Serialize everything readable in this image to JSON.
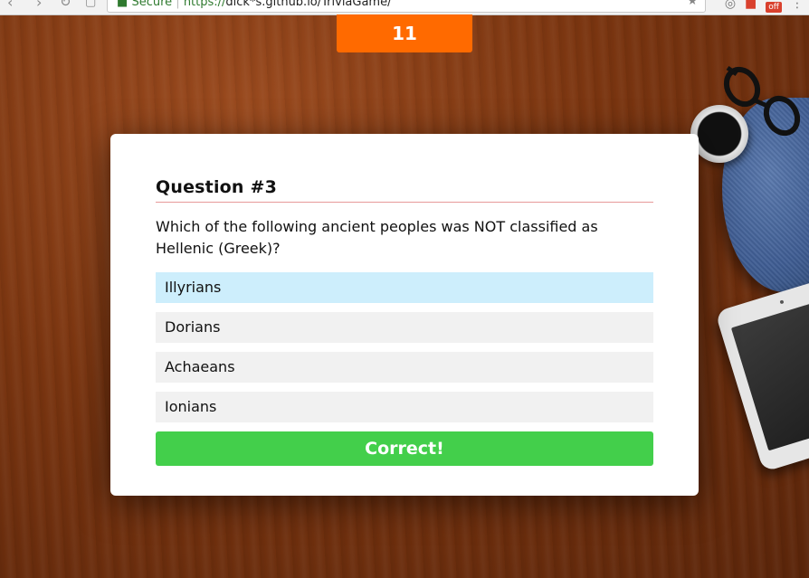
{
  "browser": {
    "secure_label": "Secure",
    "url_prefix": "https://",
    "url_rest": "dick*s.github.io/TriviaGame/",
    "off_badge": "off"
  },
  "timer": {
    "value": "11"
  },
  "quiz": {
    "title": "Question #3",
    "question": "Which of the following ancient peoples was NOT classified as Hellenic (Greek)?",
    "answers": [
      {
        "label": "Illyrians",
        "selected": true
      },
      {
        "label": "Dorians",
        "selected": false
      },
      {
        "label": "Achaeans",
        "selected": false
      },
      {
        "label": "Ionians",
        "selected": false
      }
    ],
    "result_label": "Correct!"
  },
  "colors": {
    "timer_bg": "#ff6a00",
    "selected_answer_bg": "#cdeefc",
    "answer_bg": "#f1f1f1",
    "result_bg": "#43cf4b",
    "title_rule": "#e79a9a"
  },
  "icons": {
    "back": "back-arrow-icon",
    "forward": "forward-arrow-icon",
    "reload": "reload-icon",
    "bookmark": "bookmark-icon",
    "secure": "lock-icon",
    "star": "star-icon",
    "extension": "extension-icon",
    "menu": "menu-dots-icon"
  }
}
